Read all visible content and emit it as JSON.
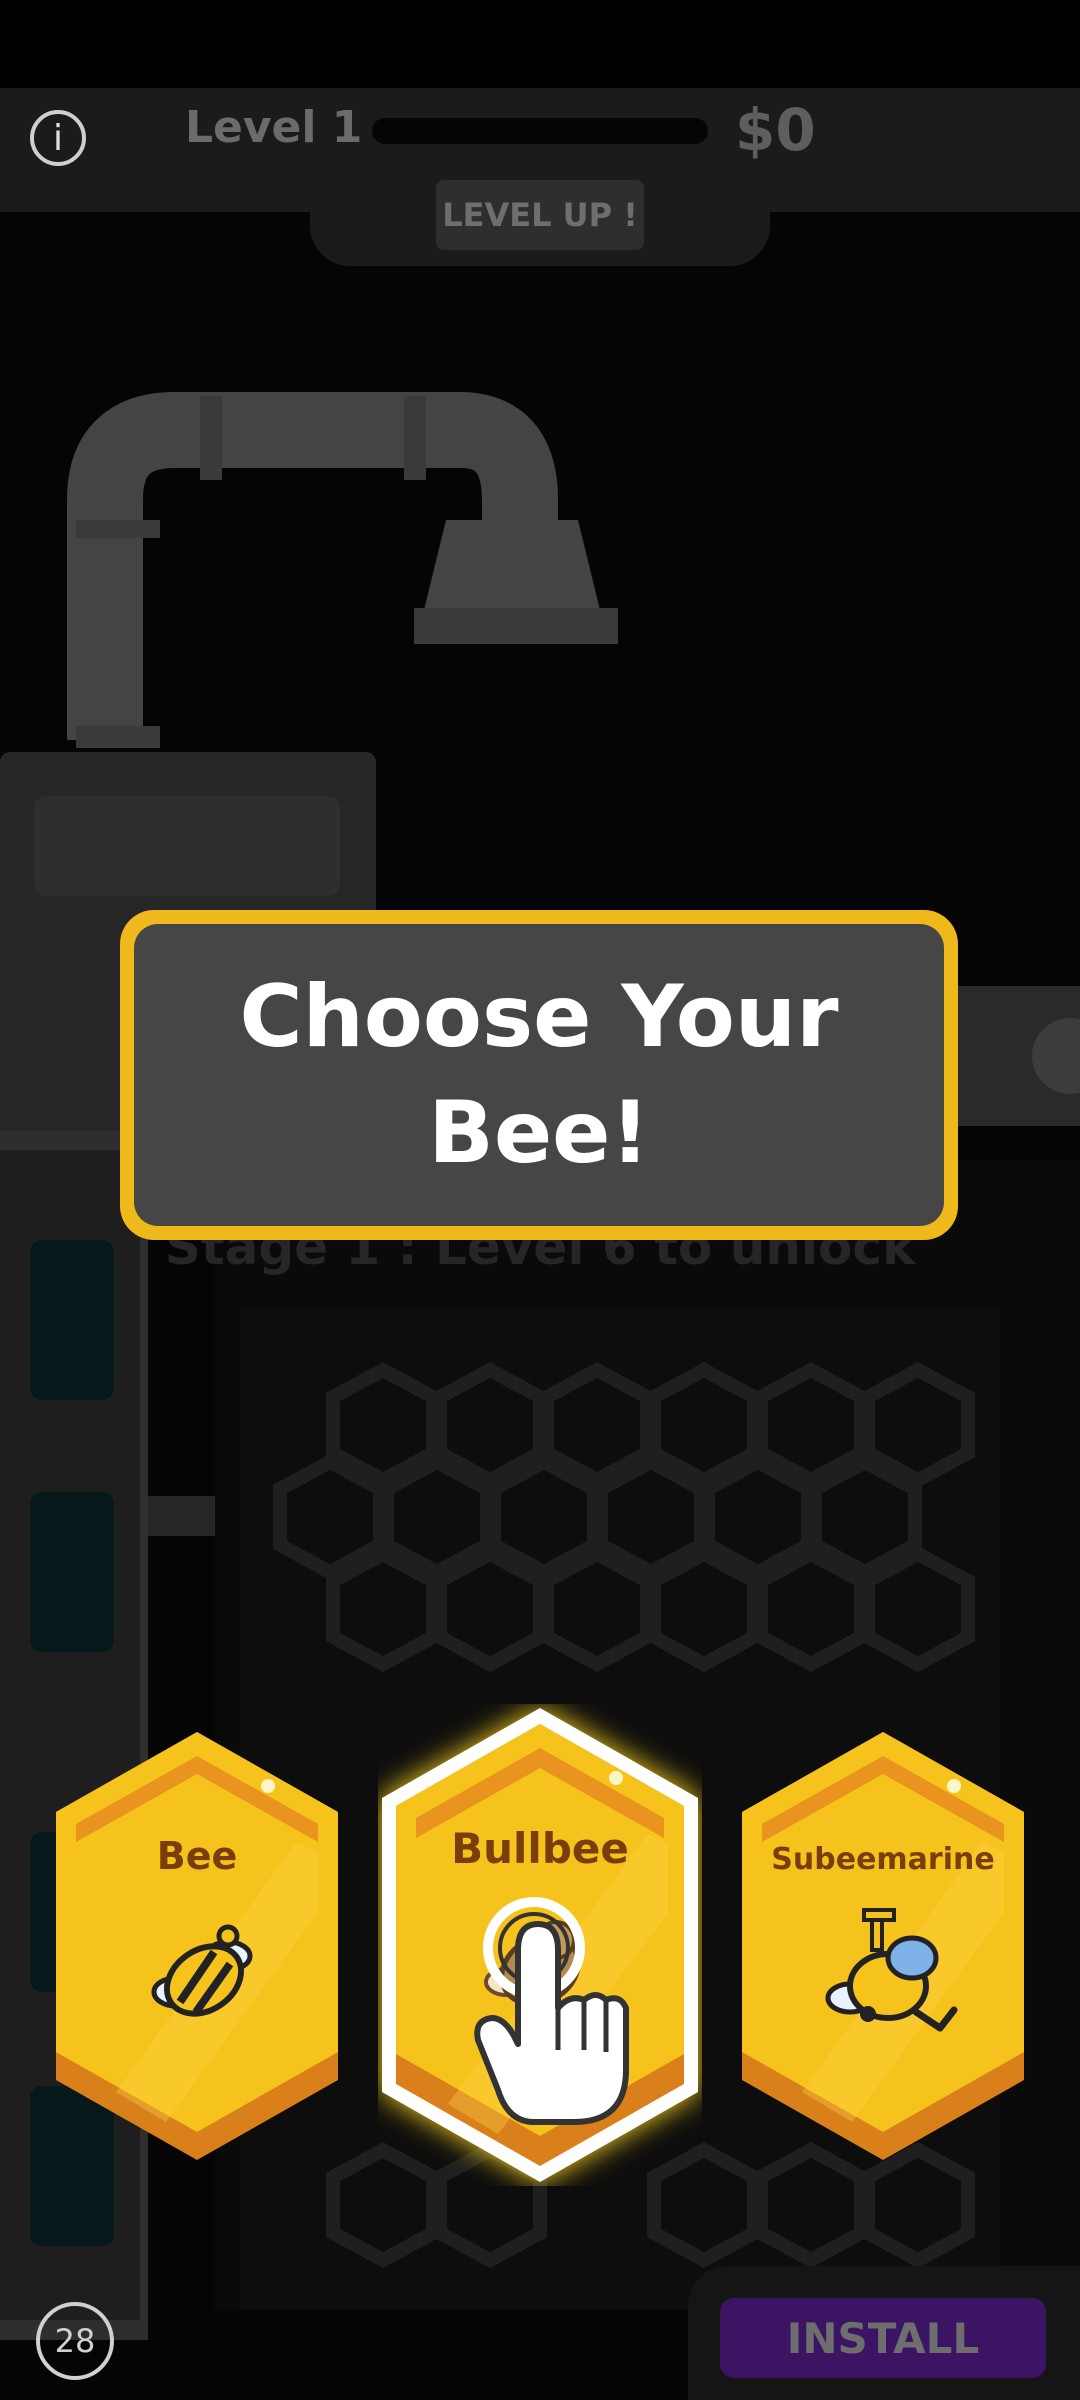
{
  "header": {
    "info_icon": "i",
    "level_label": "Level 1",
    "money": "$0",
    "level_up_label": "LEVEL UP !"
  },
  "prompt": {
    "title": "Choose Your Bee!"
  },
  "background": {
    "stage_text": "Stage 1 : Level 6 to unlock"
  },
  "bees": [
    {
      "name": "Bee",
      "icon": "bee-icon",
      "selected": false
    },
    {
      "name": "Bullbee",
      "icon": "bullbee-icon",
      "selected": true
    },
    {
      "name": "Subeemarine",
      "icon": "subeemarine-icon",
      "selected": false
    }
  ],
  "tutorial": {
    "icon": "tap-hand-icon"
  },
  "ad": {
    "install_label": "INSTALL",
    "countdown": "28"
  },
  "colors": {
    "accent_yellow": "#f6c21c",
    "panel_gray": "#464646",
    "install_purple": "#3b1463"
  }
}
